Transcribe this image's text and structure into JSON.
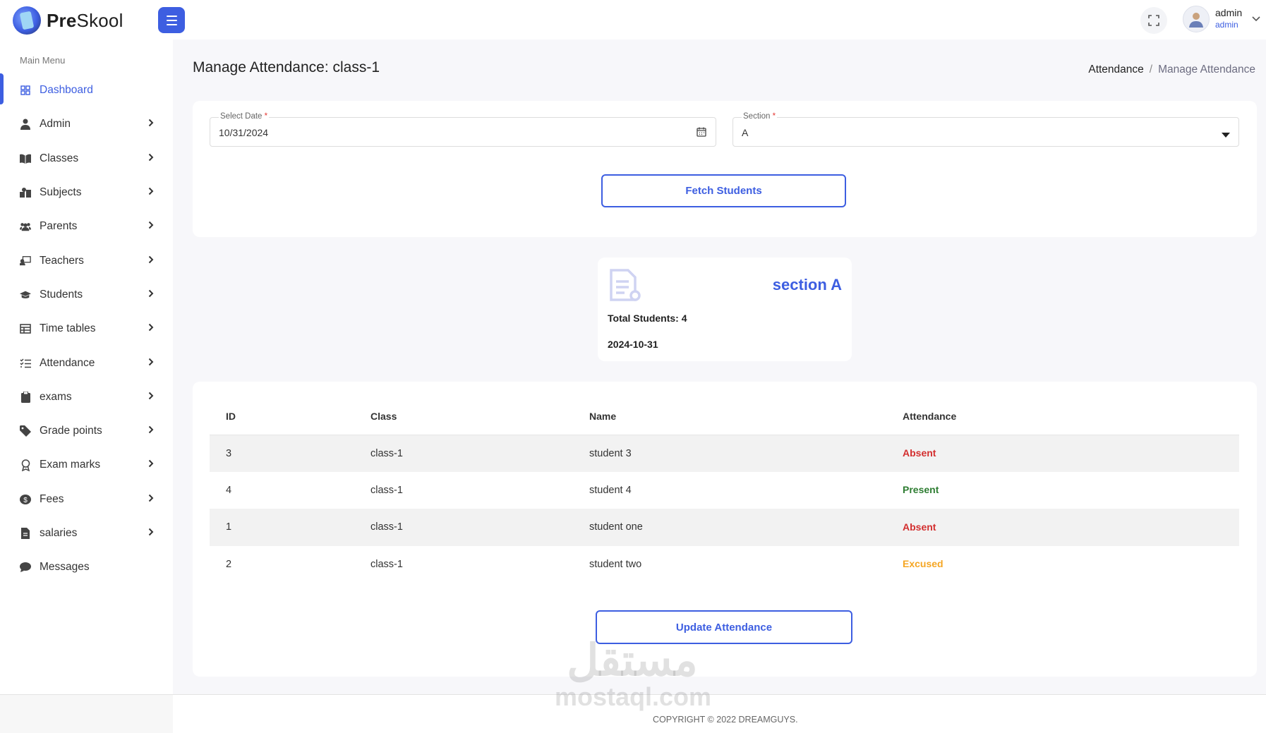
{
  "header": {
    "logo_bold": "Pre",
    "logo_rest": "Skool",
    "user_name": "admin",
    "user_role": "admin"
  },
  "sidebar": {
    "title": "Main Menu",
    "items": [
      {
        "label": "Dashboard",
        "icon": "grid-icon",
        "arrow": false
      },
      {
        "label": "Admin",
        "icon": "admin-user-icon",
        "arrow": true
      },
      {
        "label": "Classes",
        "icon": "book-icon",
        "arrow": true
      },
      {
        "label": "Subjects",
        "icon": "subjects-icon",
        "arrow": true
      },
      {
        "label": "Parents",
        "icon": "users-icon",
        "arrow": true
      },
      {
        "label": "Teachers",
        "icon": "teacher-board-icon",
        "arrow": true
      },
      {
        "label": "Students",
        "icon": "graduation-cap-icon",
        "arrow": true
      },
      {
        "label": "Time tables",
        "icon": "table-icon",
        "arrow": true
      },
      {
        "label": "Attendance",
        "icon": "checklist-icon",
        "arrow": true
      },
      {
        "label": "exams",
        "icon": "clipboard-icon",
        "arrow": true
      },
      {
        "label": "Grade points",
        "icon": "tag-icon",
        "arrow": true
      },
      {
        "label": "Exam marks",
        "icon": "award-icon",
        "arrow": true
      },
      {
        "label": "Fees",
        "icon": "money-icon",
        "arrow": true
      },
      {
        "label": "salaries",
        "icon": "invoice-icon",
        "arrow": true
      },
      {
        "label": "Messages",
        "icon": "chat-icon",
        "arrow": false
      }
    ]
  },
  "main": {
    "title": "Manage Attendance: class-1",
    "breadcrumb": {
      "root": "Attendance",
      "separator": "/",
      "current": "Manage Attendance"
    },
    "filter": {
      "date_label": "Select Date",
      "date_value": "10/31/2024",
      "section_label": "Section",
      "section_value": "A",
      "required_mark": "*",
      "fetch_button": "Fetch Students"
    },
    "summary": {
      "section_title": "section A",
      "total_students": "Total Students: 4",
      "date": "2024-10-31"
    },
    "table": {
      "headers": {
        "id": "ID",
        "class": "Class",
        "name": "Name",
        "attendance": "Attendance"
      },
      "rows": [
        {
          "id": "3",
          "class": "class-1",
          "name": "student 3",
          "attendance": "Absent"
        },
        {
          "id": "4",
          "class": "class-1",
          "name": "student 4",
          "attendance": "Present"
        },
        {
          "id": "1",
          "class": "class-1",
          "name": "student one",
          "attendance": "Absent"
        },
        {
          "id": "2",
          "class": "class-1",
          "name": "student two",
          "attendance": "Excused"
        }
      ]
    },
    "update_button": "Update Attendance"
  },
  "footer": {
    "copyright": "COPYRIGHT © 2022 DREAMGUYS."
  },
  "watermark": {
    "arabic": "مستقل",
    "latin": "mostaql.com"
  },
  "colors": {
    "accent": "#3d5ee1",
    "absent": "#d32f2f",
    "present": "#2e7d32",
    "excused": "#f5a623"
  }
}
